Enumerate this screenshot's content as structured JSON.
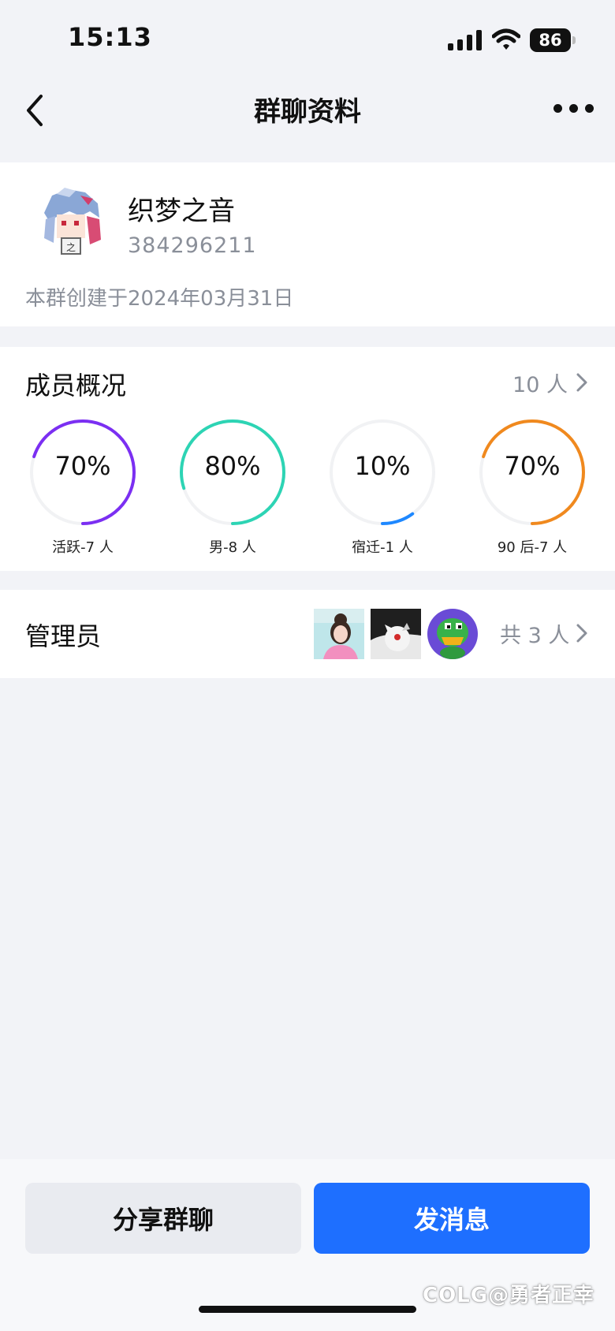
{
  "status_bar": {
    "time": "15:13",
    "battery": "86",
    "icons": [
      "signal-icon",
      "wifi-icon",
      "battery-icon"
    ]
  },
  "nav": {
    "title": "群聊资料",
    "back_icon": "chevron-left-icon",
    "more_icon": "more-dots-icon"
  },
  "group": {
    "name": "织梦之音",
    "id": "384296211",
    "created": "本群创建于2024年03月31日"
  },
  "members": {
    "title": "成员概况",
    "count": "10 人",
    "stats": [
      {
        "percent_text": "70%",
        "label": "活跃-7 人",
        "value": 0.7,
        "color": "#7b2ff2"
      },
      {
        "percent_text": "80%",
        "label": "男-8 人",
        "value": 0.8,
        "color": "#2dd4b4"
      },
      {
        "percent_text": "10%",
        "label": "宿迁-1 人",
        "value": 0.1,
        "color": "#1e88ff"
      },
      {
        "percent_text": "70%",
        "label": "90 后-7 人",
        "value": 0.7,
        "color": "#f0891e"
      }
    ]
  },
  "admins": {
    "title": "管理员",
    "count": "共 3 人",
    "avatars": [
      "avatar-girl-pink",
      "avatar-anime-red-eye",
      "avatar-green-duck"
    ]
  },
  "actions": {
    "share": "分享群聊",
    "message": "发消息"
  },
  "watermark": "COLG@勇者正幸",
  "colors": {
    "accent": "#1e6fff",
    "background": "#f2f3f7",
    "secondary_text": "#8a8f99"
  }
}
